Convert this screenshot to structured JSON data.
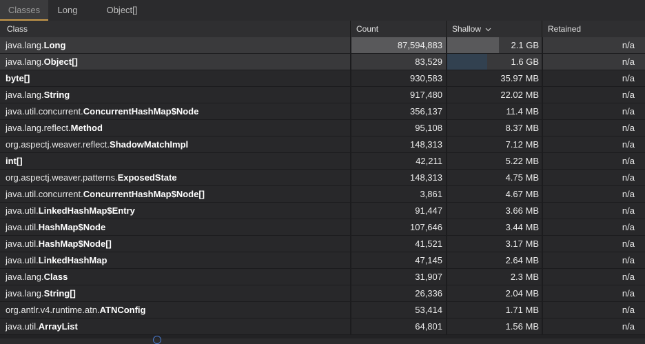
{
  "tabs": [
    {
      "label": "Classes",
      "active": true
    },
    {
      "label": "Long",
      "active": false
    },
    {
      "label": "Object[]",
      "active": false
    }
  ],
  "columns": {
    "class": "Class",
    "count": "Count",
    "shallow": "Shallow",
    "retained": "Retained"
  },
  "sort": {
    "column": "shallow",
    "direction": "descending",
    "icon": "chevron-down-icon"
  },
  "colors": {
    "accent_tab_underline": "#c99a4a",
    "count_bar_selected": "#59595b",
    "shallow_bar_selected": "#59595b",
    "count_bar_row2": "#3a3a3c",
    "shallow_bar_row2": "#324150"
  },
  "rows": [
    {
      "pkg": "java.lang.",
      "cls": "Long",
      "count": "87,594,883",
      "shallow": "2.1 GB",
      "retained": "n/a",
      "count_fill": 1.0,
      "shallow_fill": 0.55
    },
    {
      "pkg": "java.lang.",
      "cls": "Object[]",
      "count": "83,529",
      "shallow": "1.6 GB",
      "retained": "n/a",
      "count_fill": 0.0,
      "shallow_fill": 0.42
    },
    {
      "pkg": "",
      "cls": "byte[]",
      "count": "930,583",
      "shallow": "35.97 MB",
      "retained": "n/a"
    },
    {
      "pkg": "java.lang.",
      "cls": "String",
      "count": "917,480",
      "shallow": "22.02 MB",
      "retained": "n/a"
    },
    {
      "pkg": "java.util.concurrent.",
      "cls": "ConcurrentHashMap$Node",
      "count": "356,137",
      "shallow": "11.4 MB",
      "retained": "n/a"
    },
    {
      "pkg": "java.lang.reflect.",
      "cls": "Method",
      "count": "95,108",
      "shallow": "8.37 MB",
      "retained": "n/a"
    },
    {
      "pkg": "org.aspectj.weaver.reflect.",
      "cls": "ShadowMatchImpl",
      "count": "148,313",
      "shallow": "7.12 MB",
      "retained": "n/a"
    },
    {
      "pkg": "",
      "cls": "int[]",
      "count": "42,211",
      "shallow": "5.22 MB",
      "retained": "n/a"
    },
    {
      "pkg": "org.aspectj.weaver.patterns.",
      "cls": "ExposedState",
      "count": "148,313",
      "shallow": "4.75 MB",
      "retained": "n/a"
    },
    {
      "pkg": "java.util.concurrent.",
      "cls": "ConcurrentHashMap$Node[]",
      "count": "3,861",
      "shallow": "4.67 MB",
      "retained": "n/a"
    },
    {
      "pkg": "java.util.",
      "cls": "LinkedHashMap$Entry",
      "count": "91,447",
      "shallow": "3.66 MB",
      "retained": "n/a"
    },
    {
      "pkg": "java.util.",
      "cls": "HashMap$Node",
      "count": "107,646",
      "shallow": "3.44 MB",
      "retained": "n/a"
    },
    {
      "pkg": "java.util.",
      "cls": "HashMap$Node[]",
      "count": "41,521",
      "shallow": "3.17 MB",
      "retained": "n/a"
    },
    {
      "pkg": "java.util.",
      "cls": "LinkedHashMap",
      "count": "47,145",
      "shallow": "2.64 MB",
      "retained": "n/a"
    },
    {
      "pkg": "java.lang.",
      "cls": "Class",
      "count": "31,907",
      "shallow": "2.3 MB",
      "retained": "n/a"
    },
    {
      "pkg": "java.lang.",
      "cls": "String[]",
      "count": "26,336",
      "shallow": "2.04 MB",
      "retained": "n/a"
    },
    {
      "pkg": "org.antlr.v4.runtime.atn.",
      "cls": "ATNConfig",
      "count": "53,414",
      "shallow": "1.71 MB",
      "retained": "n/a"
    },
    {
      "pkg": "java.util.",
      "cls": "ArrayList",
      "count": "64,801",
      "shallow": "1.56 MB",
      "retained": "n/a"
    }
  ]
}
